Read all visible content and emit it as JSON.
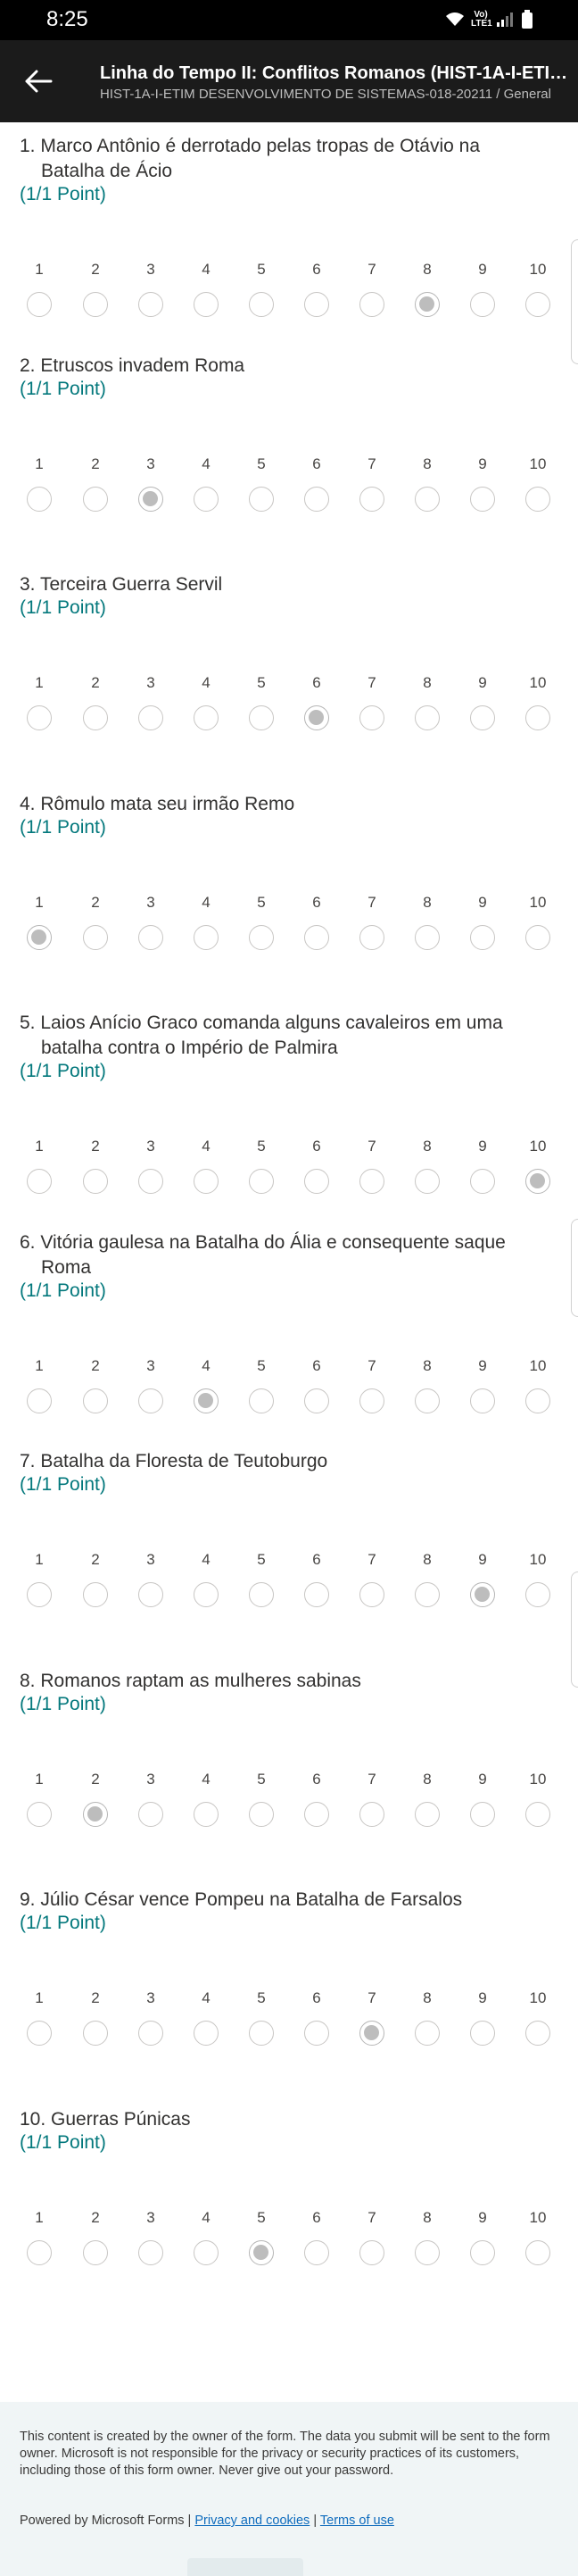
{
  "status_bar": {
    "time": "8:25",
    "network": "Vo) LTE1"
  },
  "header": {
    "title": "Linha do Tempo II: Conflitos Romanos (HIST-1A-I-ETIM DE...",
    "subtitle": "HIST-1A-I-ETIM DESENVOLVIMENTO DE SISTEMAS-018-20211 / General"
  },
  "scale_labels": [
    "1",
    "2",
    "3",
    "4",
    "5",
    "6",
    "7",
    "8",
    "9",
    "10"
  ],
  "questions": [
    {
      "number": "1.",
      "text": "Marco Antônio é derrotado pelas tropas de Otávio na Batalha de Ácio",
      "points": "(1/1 Point)",
      "selected": 8
    },
    {
      "number": "2.",
      "text": "Etruscos invadem Roma",
      "points": "(1/1 Point)",
      "selected": 3
    },
    {
      "number": "3.",
      "text": "Terceira Guerra Servil",
      "points": "(1/1 Point)",
      "selected": 6
    },
    {
      "number": "4.",
      "text": "Rômulo mata seu irmão Remo",
      "points": "(1/1 Point)",
      "selected": 1
    },
    {
      "number": "5.",
      "text": "Laios Anício Graco comanda alguns cavaleiros em uma batalha contra o Império de Palmira",
      "points": "(1/1 Point)",
      "selected": 10
    },
    {
      "number": "6.",
      "text": "Vitória gaulesa na Batalha do Ália e consequente saque Roma",
      "points": "(1/1 Point)",
      "selected": 4
    },
    {
      "number": "7.",
      "text": "Batalha da Floresta de Teutoburgo",
      "points": "(1/1 Point)",
      "selected": 9
    },
    {
      "number": "8.",
      "text": "Romanos raptam as mulheres sabinas",
      "points": "(1/1 Point)",
      "selected": 2
    },
    {
      "number": "9.",
      "text": "Júlio César vence Pompeu na Batalha de Farsalos",
      "points": "(1/1 Point)",
      "selected": 7
    },
    {
      "number": "10.",
      "text": "Guerras Púnicas",
      "points": "(1/1 Point)",
      "selected": 5
    }
  ],
  "footer": {
    "disclaimer": "This content is created by the owner of the form. The data you submit will be sent to the form owner. Microsoft is not responsible for the privacy or security practices of its customers, including those of this form owner. Never give out your password.",
    "powered_by": "Powered by Microsoft Forms |",
    "privacy_link": "Privacy and cookies",
    "separator": "|",
    "terms_link": "Terms of use"
  },
  "colors": {
    "points": "#03787c",
    "header_bg": "#1b1b1b",
    "footer_bg": "#f0f5f6",
    "link": "#0f6cbd"
  }
}
